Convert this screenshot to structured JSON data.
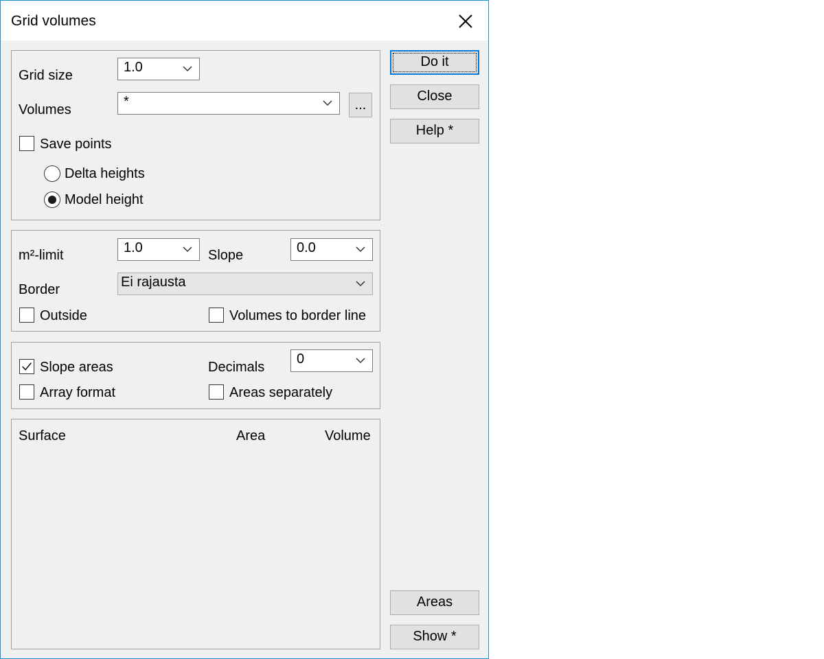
{
  "dialog": {
    "title": "Grid volumes"
  },
  "group1": {
    "grid_size_label": "Grid size",
    "grid_size_value": "1.0",
    "volumes_label": "Volumes",
    "volumes_value": "*",
    "browse_label": "...",
    "save_points_label": "Save points",
    "save_points_checked": false,
    "delta_heights_label": "Delta heights",
    "model_height_label": "Model height",
    "selected_height_mode": "Model height"
  },
  "group2": {
    "m2_limit_label": "m²-limit",
    "m2_limit_value": "1.0",
    "slope_label": "Slope",
    "slope_value": "0.0",
    "border_label": "Border",
    "border_value": "Ei rajausta",
    "outside_label": "Outside",
    "outside_checked": false,
    "volumes_to_border_label": "Volumes to border line",
    "volumes_to_border_checked": false
  },
  "group3": {
    "slope_areas_label": "Slope areas",
    "slope_areas_checked": true,
    "array_format_label": "Array format",
    "array_format_checked": false,
    "decimals_label": "Decimals",
    "decimals_value": "0",
    "areas_separately_label": "Areas separately",
    "areas_separately_checked": false
  },
  "results": {
    "columns": [
      "Surface",
      "Area",
      "Volume"
    ],
    "rows": []
  },
  "buttons": {
    "do_it": "Do it",
    "close": "Close",
    "help": "Help *",
    "areas": "Areas",
    "show": "Show *"
  },
  "colors": {
    "accent": "#0078d7",
    "window_border": "#1b8fd1",
    "dialog_bg": "#f0f0f0"
  },
  "icons": {
    "close": "close-icon",
    "dropdown": "chevron-down-icon",
    "checked": "checkmark-icon"
  }
}
